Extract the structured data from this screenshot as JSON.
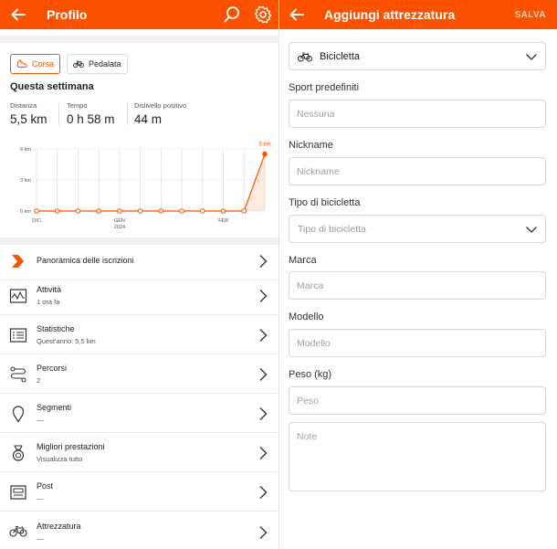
{
  "profile": {
    "title": "Profilo",
    "tabs": [
      {
        "label": "Corsa",
        "icon": "running-shoe-icon",
        "active": true
      },
      {
        "label": "Pedalata",
        "icon": "bicycle-icon",
        "active": false
      }
    ],
    "week_title": "Questa settimana",
    "stats": [
      {
        "label": "Distanza",
        "value": "5,5 km"
      },
      {
        "label": "Tempo",
        "value": "0 h 58 m"
      },
      {
        "label": "Dislivello positivo",
        "value": "44 m"
      }
    ],
    "menu": [
      {
        "label": "Panoramica delle iscrizioni",
        "sub": "",
        "icon": "subscription-chevron-icon"
      },
      {
        "label": "Attività",
        "sub": "1 ora fa",
        "icon": "activity-chart-icon"
      },
      {
        "label": "Statistiche",
        "sub": "Quest'anno: 5,5 km",
        "icon": "statistics-list-icon"
      },
      {
        "label": "Percorsi",
        "sub": "2",
        "icon": "route-icon"
      },
      {
        "label": "Segmenti",
        "sub": "—",
        "icon": "segment-pin-icon"
      },
      {
        "label": "Migliori prestazioni",
        "sub": "Visualizza tutto",
        "icon": "medal-icon"
      },
      {
        "label": "Post",
        "sub": "—",
        "icon": "post-icon"
      },
      {
        "label": "Attrezzatura",
        "sub": "—",
        "icon": "bicycle-icon"
      }
    ]
  },
  "chart_data": {
    "type": "line",
    "x": [
      "DIC",
      "",
      "",
      "",
      "GEN",
      "",
      "",
      "",
      "",
      "FEB",
      "",
      ""
    ],
    "x_ticks": [
      "DIC",
      "GEN",
      "FEB"
    ],
    "year_label": "2024",
    "series": [
      {
        "values": [
          0,
          0,
          0,
          0,
          0,
          0,
          0,
          0,
          0,
          0,
          0,
          5.5
        ]
      }
    ],
    "y_ticks": [
      "0 km",
      "3 km",
      "6 km"
    ],
    "ylim": [
      0,
      6
    ],
    "annotation": "5 km",
    "color": "#fc5200",
    "grid": true
  },
  "gear_form": {
    "title": "Aggiungi attrezzatura",
    "save_label": "SALVA",
    "gear_type": "Bicicletta",
    "fields": {
      "default_sports": {
        "label": "Sport predefiniti",
        "placeholder": "Nessuna"
      },
      "nickname": {
        "label": "Nickname",
        "placeholder": "Nickname"
      },
      "bike_type": {
        "label": "Tipo di bicicletta",
        "placeholder": "Tipo di bicicletta"
      },
      "brand": {
        "label": "Marca",
        "placeholder": "Marca"
      },
      "model": {
        "label": "Modello",
        "placeholder": "Modello"
      },
      "weight": {
        "label": "Peso (kg)",
        "placeholder": "Peso"
      },
      "notes": {
        "placeholder": "Note"
      }
    }
  },
  "colors": {
    "accent": "#fc5200",
    "divider": "#e8e8e8",
    "strip": "#efefef"
  }
}
